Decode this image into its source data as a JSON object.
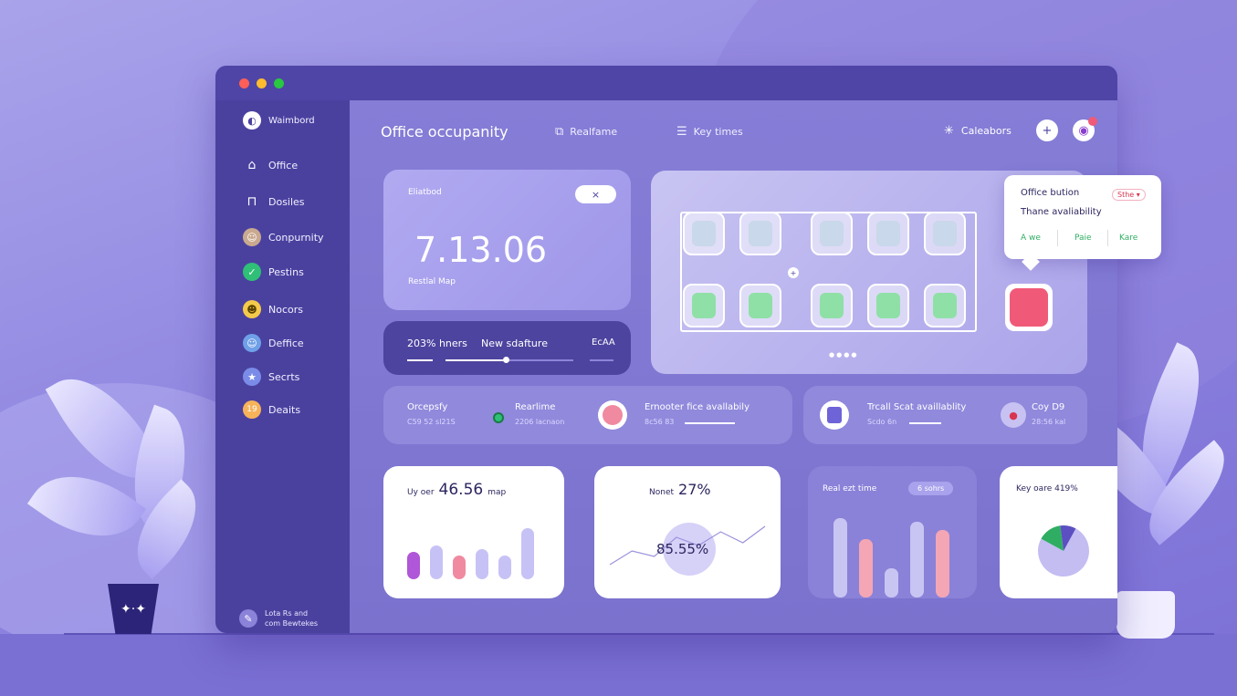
{
  "sidebar": {
    "brand": "Waimbord",
    "items": [
      {
        "label": "Office",
        "icon": "office-icon"
      },
      {
        "label": "Dosiles",
        "icon": "desk-icon"
      },
      {
        "label": "Conpurnity",
        "icon": "community-avatar-icon"
      },
      {
        "label": "Pestins",
        "icon": "check-badge-icon"
      },
      {
        "label": "Nocors",
        "icon": "smile-avatar-icon"
      },
      {
        "label": "Deffice",
        "icon": "person-avatar-icon"
      },
      {
        "label": "Secrts",
        "icon": "star-badge-icon"
      },
      {
        "label": "Deaits",
        "icon": "number-badge-icon"
      }
    ],
    "footer_line1": "Lota Rs and",
    "footer_line2": "com Bewtekes"
  },
  "header": {
    "title": "Office occupanity",
    "tab1": "Realfame",
    "tab2": "Key times",
    "right_label": "Caleabors"
  },
  "stat_card": {
    "label": "Eliatbod",
    "value": "7.13.06",
    "sublabel": "Restlal Map",
    "toggle_icon": "×"
  },
  "progress_card": {
    "label1": "203% hners",
    "label2": "New sdafture",
    "label3": "EcAA"
  },
  "seat_map": {
    "page_dots": "●●●●"
  },
  "popup": {
    "title": "Office bution",
    "badge": "Sthe ▾",
    "subtitle": "Thane avaliability",
    "opt1": "A we",
    "opt2": "Paie",
    "opt3": "Kare"
  },
  "info_row": {
    "item1_title": "Orcepsfy",
    "item1_sub": "C59 52 sl21S",
    "item2_title": "Rearlime",
    "item2_sub": "2206 lacnaon",
    "item3_title": "Ernooter fice avallabily",
    "item3_sub": "8c56 83",
    "item4_title": "Trcall Scat availlablity",
    "item4_sub": "Scdo 6n",
    "item5_title": "Coy D9",
    "item5_sub": "28:56 kal"
  },
  "chart1": {
    "label": "Uy oer",
    "value": "46.56",
    "unit": "map"
  },
  "chart2": {
    "label": "Nonet",
    "value": "27%",
    "center_value": "85.55%"
  },
  "chart3": {
    "label": "Real ezt time",
    "badge": "6 sohrs"
  },
  "chart4": {
    "label": "Key oare 419%"
  },
  "chart_data": [
    {
      "type": "bar",
      "values": [
        0.4,
        0.5,
        0.35,
        0.45,
        0.35,
        0.75
      ],
      "colors": [
        "#b056d8",
        "#c7c2f5",
        "#f08aa0",
        "#c7c2f5",
        "#c7c2f5",
        "#c7c2f5"
      ]
    },
    {
      "type": "line",
      "values": [
        0.2,
        0.45,
        0.35,
        0.7,
        0.55,
        0.8,
        0.6,
        0.9
      ]
    },
    {
      "type": "bar",
      "values": [
        0.95,
        0.7,
        0.35,
        0.9,
        0.8
      ],
      "colors": [
        "#c9c5f3",
        "#f4a6b4",
        "#c9c5f3",
        "#c9c5f3",
        "#f4a6b4"
      ]
    },
    {
      "type": "pie",
      "values": [
        75,
        15,
        10
      ],
      "colors": [
        "#c3bdf2",
        "#2fae63",
        "#5b4fc2"
      ]
    }
  ],
  "colors": {
    "seat_free": "#c9d8ea",
    "seat_taken": "#8fe0a6",
    "seat_alert": "#f05a78",
    "accent": "#4a419f"
  }
}
